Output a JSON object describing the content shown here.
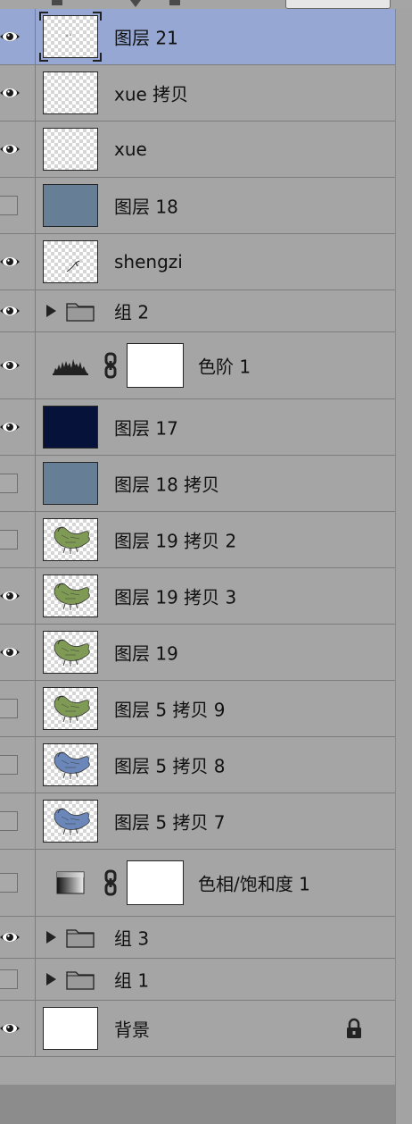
{
  "layers": [
    {
      "name": "图层 21",
      "visible": true,
      "kind": "pixel",
      "thumb": "checker-dots",
      "selected": true
    },
    {
      "name": "xue 拷贝",
      "visible": true,
      "kind": "pixel",
      "thumb": "checker"
    },
    {
      "name": "xue",
      "visible": true,
      "kind": "pixel",
      "thumb": "checker"
    },
    {
      "name": "图层 18",
      "visible": false,
      "kind": "pixel",
      "thumb": "bluegray"
    },
    {
      "name": "shengzi",
      "visible": true,
      "kind": "pixel",
      "thumb": "checker-rope"
    },
    {
      "name": "组 2",
      "visible": true,
      "kind": "group"
    },
    {
      "name": "色阶 1",
      "visible": true,
      "kind": "adjustment",
      "adjustment_icon": "levels-histogram-icon"
    },
    {
      "name": "图层 17",
      "visible": true,
      "kind": "pixel",
      "thumb": "navy"
    },
    {
      "name": "图层 18 拷贝",
      "visible": false,
      "kind": "pixel",
      "thumb": "bluegray"
    },
    {
      "name": "图层 19 拷贝 2",
      "visible": false,
      "kind": "pixel",
      "thumb": "green-bird"
    },
    {
      "name": "图层 19 拷贝 3",
      "visible": true,
      "kind": "pixel",
      "thumb": "green-bird"
    },
    {
      "name": "图层 19",
      "visible": true,
      "kind": "pixel",
      "thumb": "green-bird"
    },
    {
      "name": "图层 5 拷贝 9",
      "visible": false,
      "kind": "pixel",
      "thumb": "green-bird"
    },
    {
      "name": "图层 5 拷贝 8",
      "visible": false,
      "kind": "pixel",
      "thumb": "blue-bird"
    },
    {
      "name": "图层 5 拷贝 7",
      "visible": false,
      "kind": "pixel",
      "thumb": "blue-bird"
    },
    {
      "name": "色相/饱和度 1",
      "visible": false,
      "kind": "adjustment",
      "adjustment_icon": "hue-saturation-icon"
    },
    {
      "name": "组 3",
      "visible": true,
      "kind": "group"
    },
    {
      "name": "组 1",
      "visible": false,
      "kind": "group"
    },
    {
      "name": "背景",
      "visible": true,
      "kind": "pixel",
      "thumb": "white",
      "locked": true
    }
  ],
  "colors": {
    "panel_bg": "#a5a5a5",
    "selected_bg": "#95a7d2",
    "divider": "#7e7e7e",
    "bluegray_fill": "#667f96",
    "navy_fill": "#07123a",
    "bird_green": "#7f9a54",
    "bird_blue": "#6b86b8"
  }
}
